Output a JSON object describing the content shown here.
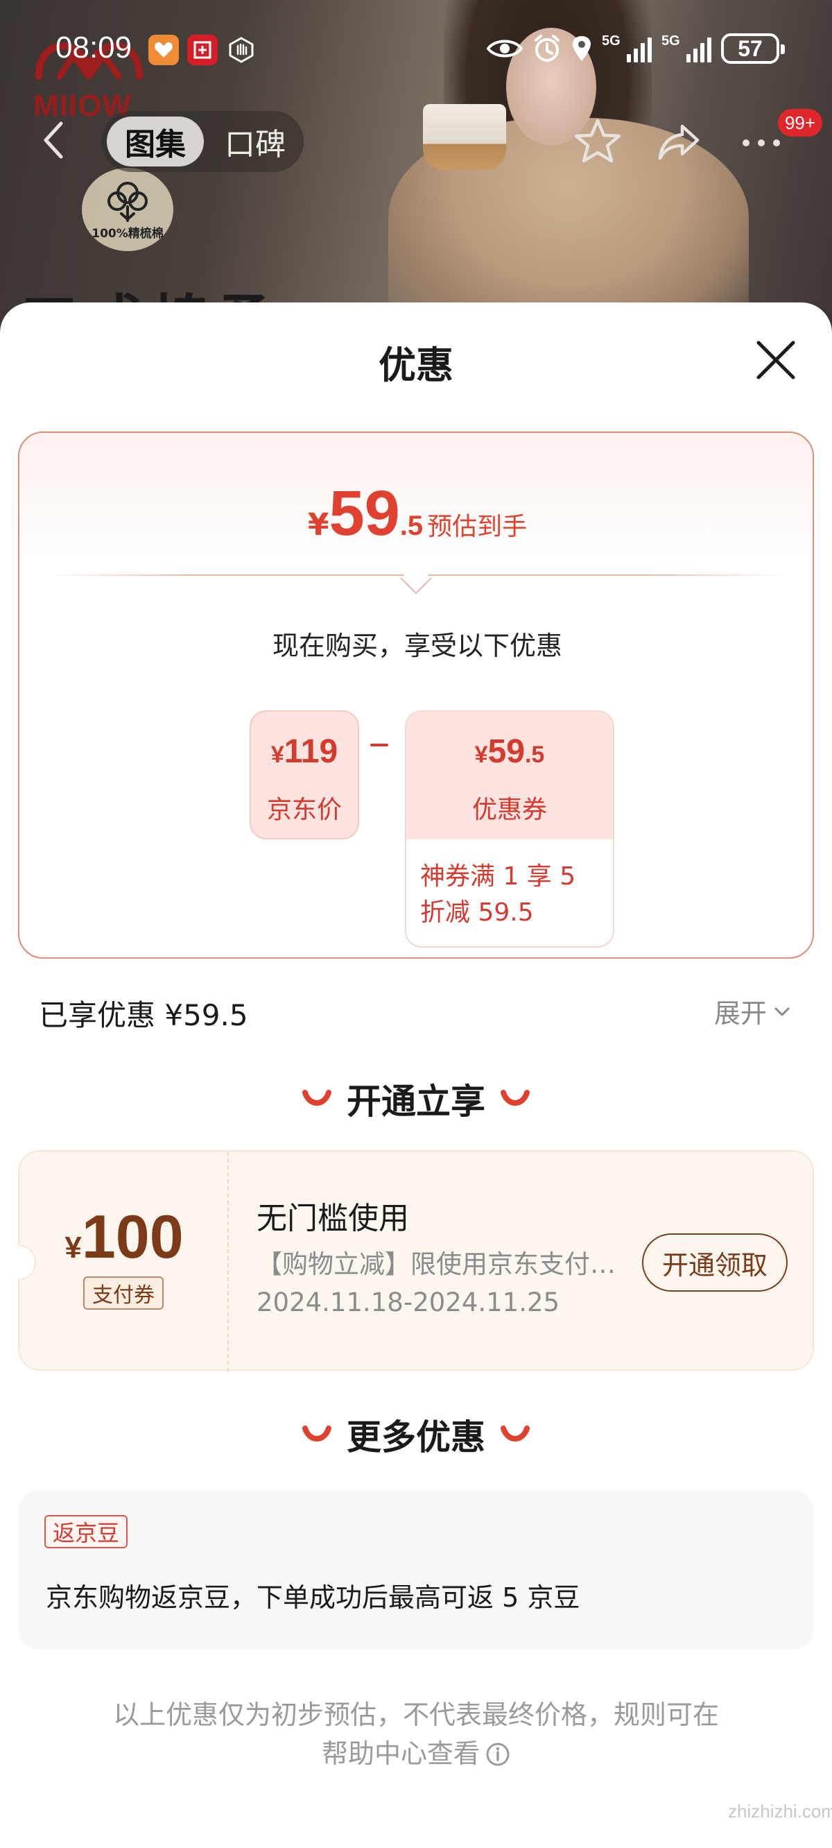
{
  "status_bar": {
    "time": "08:09",
    "signal1": "5G",
    "signal2": "5G",
    "battery": "57"
  },
  "hero": {
    "brand": "MIIOW",
    "badge": "100%精梳棉",
    "title_partial": "三成棉柔"
  },
  "nav": {
    "tabs": [
      "图集",
      "口碑"
    ],
    "badge": "99+"
  },
  "sheet": {
    "title": "优惠",
    "estimate": {
      "yen": "¥",
      "int": "59",
      "dec": ".5",
      "label": "预估到手"
    },
    "buy_line": "现在购买，享受以下优惠",
    "jd_price": {
      "yen": "¥",
      "amount": "119",
      "label": "京东价"
    },
    "coupon": {
      "yen": "¥",
      "int": "59",
      "dec": ".5",
      "label": "优惠券",
      "desc": "神券满 1 享 5 折减 59.5"
    },
    "enjoyed": "已享优惠 ¥59.5",
    "expand": "展开",
    "section_open": "开通立享",
    "pay_coupon": {
      "yen": "¥",
      "amount": "100",
      "tag": "支付券",
      "title": "无门槛使用",
      "subtitle": "【购物立减】限使用京东支付…",
      "date": "2024.11.18-2024.11.25",
      "button": "开通领取"
    },
    "section_more": "更多优惠",
    "bean": {
      "tag": "返京豆",
      "text": "京东购物返京豆，下单成功后最高可返 5 京豆"
    },
    "footer": "以上优惠仅为初步预估，不代表最终价格，规则可在帮助中心查看"
  },
  "watermark": "zhizhizhi.com",
  "colors": {
    "accent": "#e0412f",
    "coupon_brown": "#7b3b19",
    "muted": "#9a9a9a"
  }
}
